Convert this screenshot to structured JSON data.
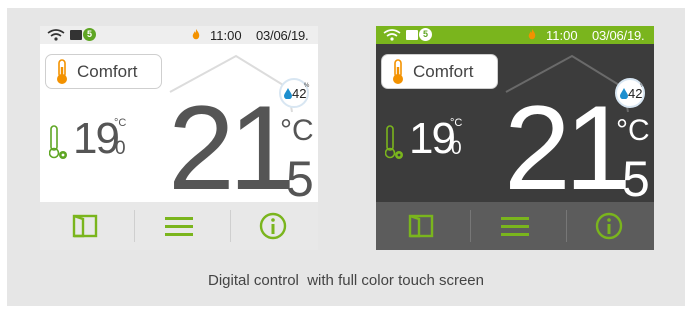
{
  "screens": [
    {
      "theme": "light",
      "status": {
        "badge": "5",
        "time": "11:00",
        "date": "03/06/19."
      },
      "mode": {
        "label": "Comfort"
      },
      "humidity": {
        "value": "42",
        "unit": "%"
      },
      "setpoint": {
        "int": "19",
        "dec": "0",
        "unit": "°C"
      },
      "room": {
        "int": "21",
        "dec": "5",
        "unit": "°C"
      }
    },
    {
      "theme": "dark",
      "status": {
        "badge": "5",
        "time": "11:00",
        "date": "03/06/19."
      },
      "mode": {
        "label": "Comfort"
      },
      "humidity": {
        "value": "42",
        "unit": "%"
      },
      "setpoint": {
        "int": "19",
        "dec": "0",
        "unit": "°C"
      },
      "room": {
        "int": "21",
        "dec": "5",
        "unit": "°C"
      }
    }
  ],
  "caption": "Digital control  with full color touch screen",
  "colors": {
    "accent_green": "#7ab51d",
    "flame_orange": "#f39200",
    "drop_blue": "#1d8fcf"
  }
}
